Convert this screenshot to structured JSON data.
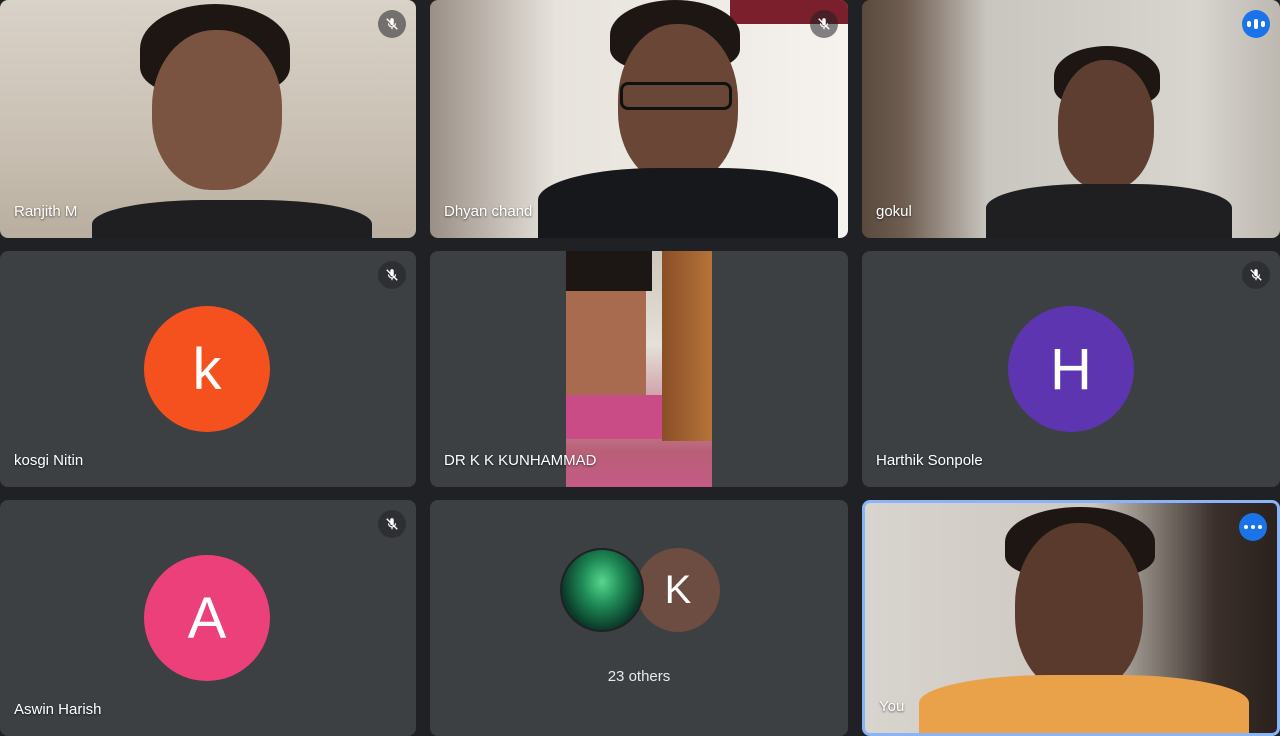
{
  "participants": [
    {
      "name": "Ranjith M",
      "muted": true
    },
    {
      "name": "Dhyan chand",
      "muted": true
    },
    {
      "name": "gokul",
      "speaking": true
    },
    {
      "name": "kosgi Nitin",
      "initial": "k",
      "avatar_color": "#f4511e",
      "muted": true
    },
    {
      "name": "DR K K KUNHAMMAD"
    },
    {
      "name": "Harthik Sonpole",
      "initial": "H",
      "avatar_color": "#5e35b1",
      "muted": true
    },
    {
      "name": "Aswin Harish",
      "initial": "A",
      "avatar_color": "#ec407a",
      "muted": true
    },
    {
      "name": "You"
    }
  ],
  "others": {
    "label": "23 others",
    "second_initial": "K",
    "second_color": "#6d4c41"
  },
  "icons": {
    "muted": "mic-off-icon",
    "speaking": "audio-level-icon",
    "more": "more-options-icon"
  },
  "accent": "#1a73e8",
  "self_border": "#8ab4f8"
}
